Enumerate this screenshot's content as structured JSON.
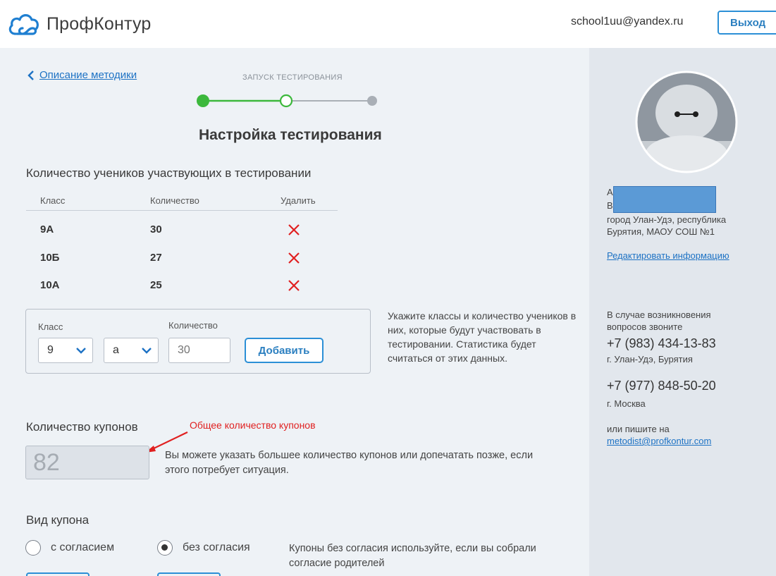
{
  "header": {
    "logo_text": "ПрофКонтур",
    "user_email": "school1uu@yandex.ru",
    "logout_label": "Выход"
  },
  "nav": {
    "back_label": "Описание методики",
    "step_label": "ЗАПУСК ТЕСТИРОВАНИЯ",
    "steps": [
      "done",
      "current",
      "pending"
    ]
  },
  "page_title": "Настройка тестирования",
  "students": {
    "title": "Количество учеников участвующих в тестировании",
    "columns": [
      "Класс",
      "Количество",
      "Удалить"
    ],
    "rows": [
      {
        "class": "9А",
        "count": "30"
      },
      {
        "class": "10Б",
        "count": "27"
      },
      {
        "class": "10А",
        "count": "25"
      }
    ]
  },
  "add_form": {
    "class_label": "Класс",
    "count_label": "Количество",
    "grade_value": "9",
    "letter_value": "а",
    "count_placeholder": "30",
    "add_label": "Добавить",
    "hint": "Укажите классы и количество учеников в них, которые будут участвовать в тестировании. Статистика будет считаться от этих данных."
  },
  "coupons": {
    "title": "Количество купонов",
    "annotation": "Общее количество купонов",
    "value": "82",
    "hint": "Вы можете указать большее количество купонов или допечатать позже, если этого потребует ситуация."
  },
  "coupon_type": {
    "title": "Вид купона",
    "options": [
      {
        "label": "с согласием",
        "selected": false
      },
      {
        "label": "без согласия",
        "selected": true
      }
    ],
    "hint": "Купоны без согласия используйте, если вы собрали согласие родителей"
  },
  "sidebar": {
    "name_line1": "А",
    "name_line2": "В",
    "location": "город Улан-Удэ, республика Бурятия, МАОУ СОШ №1",
    "edit_link": "Редактировать информацию",
    "contact_intro": "В случае возникновения вопросов звоните",
    "phone1": "+7 (983) 434-13-83",
    "phone1_city": "г. Улан-Удэ, Бурятия",
    "phone2": "+7 (977) 848-50-20",
    "phone2_city": "г. Москва",
    "email_intro": "или пишите на",
    "email": "metodist@profkontur.com"
  },
  "colors": {
    "accent": "#2b8fd6",
    "step_done": "#3cb83c",
    "delete": "#e02020",
    "annotation": "#e02020"
  }
}
